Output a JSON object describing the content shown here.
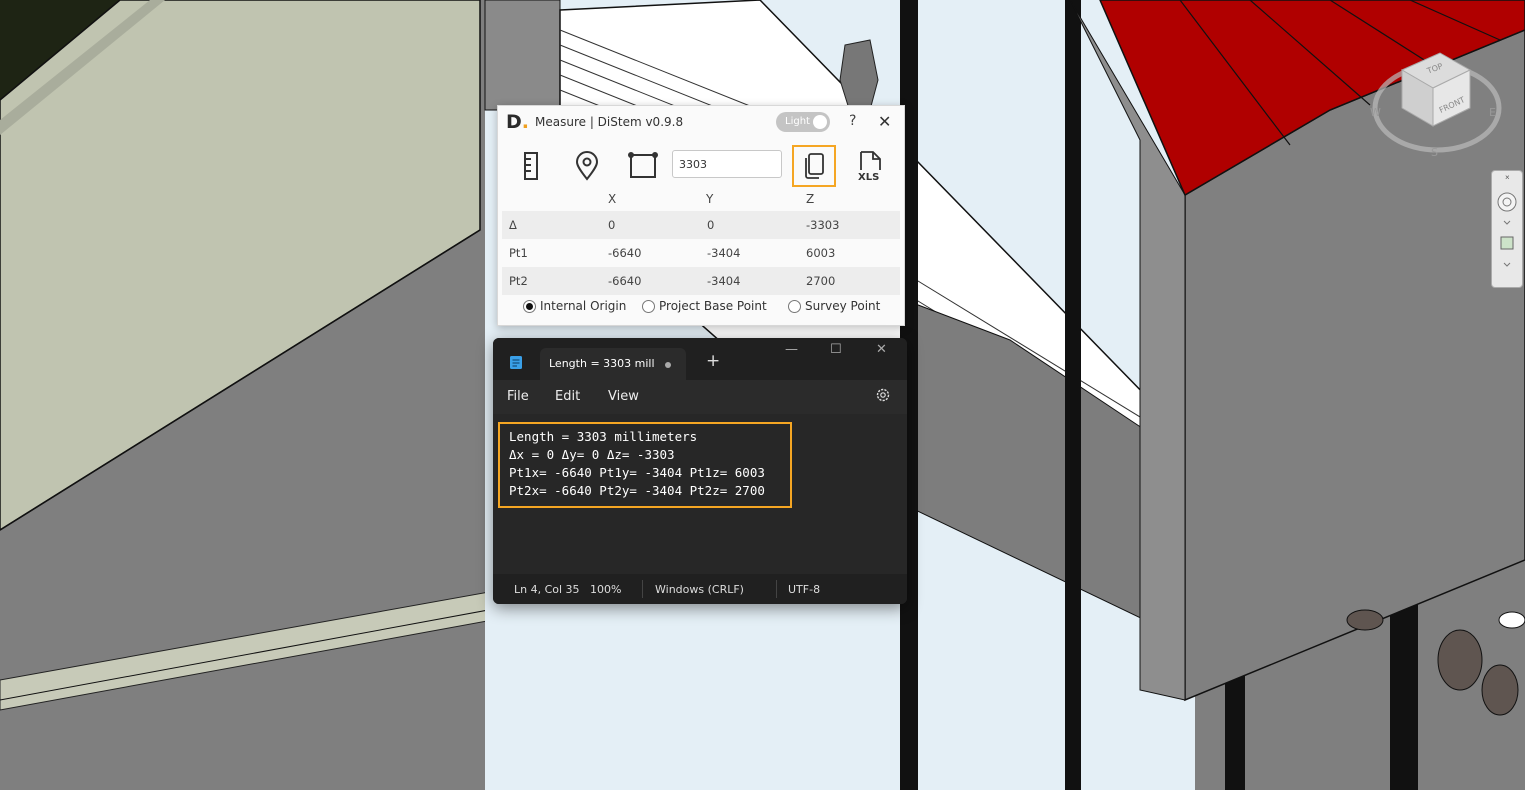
{
  "measure": {
    "logo_letter": "D",
    "logo_dot": ".",
    "title": "Measure | DiStem v0.9.8",
    "theme_toggle": "Light",
    "help": "?",
    "close": "✕",
    "length_value": "3303",
    "xls_label": "XLS",
    "columns": [
      "X",
      "Y",
      "Z"
    ],
    "rows": [
      {
        "label": "Δ",
        "x": "0",
        "y": "0",
        "z": "-3303"
      },
      {
        "label": "Pt1",
        "x": "-6640",
        "y": "-3404",
        "z": "6003"
      },
      {
        "label": "Pt2",
        "x": "-6640",
        "y": "-3404",
        "z": "2700"
      }
    ],
    "origins": [
      {
        "label": "Internal Origin",
        "selected": true
      },
      {
        "label": "Project Base Point",
        "selected": false
      },
      {
        "label": "Survey Point",
        "selected": false
      }
    ]
  },
  "notepad": {
    "tab_title": "Length = 3303 mill",
    "new_tab": "+",
    "menu": [
      "File",
      "Edit",
      "View"
    ],
    "lines": [
      "Length = 3303 millimeters",
      "Δx = 0 Δy= 0 Δz= -3303",
      "Pt1x= -6640 Pt1y= -3404 Pt1z= 6003",
      "Pt2x= -6640 Pt2y= -3404 Pt2z= 2700"
    ],
    "status": {
      "position": "Ln 4, Col 35",
      "zoom": "100%",
      "line_endings": "Windows (CRLF)",
      "encoding": "UTF-8"
    }
  },
  "viewcube": {
    "top": "TOP",
    "front": "FRONT",
    "compass": [
      "W",
      "E",
      "S"
    ]
  },
  "colors": {
    "highlight": "#f5a623",
    "roof": "#b00000",
    "notepad_bg": "#272727"
  }
}
